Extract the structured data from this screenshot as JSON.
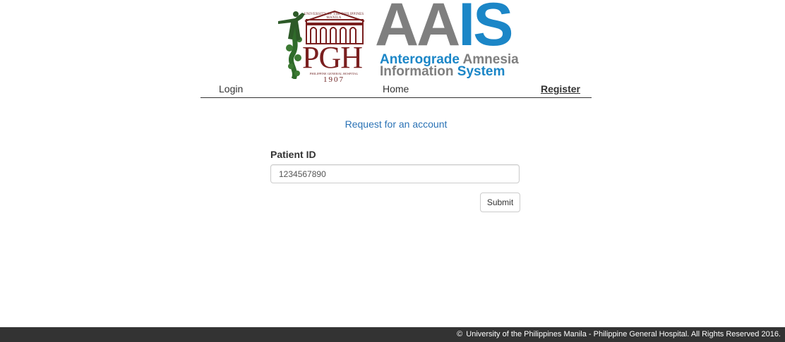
{
  "logo": {
    "seal_university": "UNIVERSITY OF THE PHILIPPINES MANILA",
    "seal_letters": "PGH",
    "seal_hospital": "PHILIPPINE GENERAL HOSPITAL",
    "seal_year": "1907",
    "title_gray": "AA",
    "title_blue": "IS",
    "sub_anterograde": "Anterograde",
    "sub_amnesia": "Amnesia",
    "sub_information": "Information",
    "sub_system": "System"
  },
  "nav": {
    "login": "Login",
    "home": "Home",
    "register": "Register"
  },
  "form": {
    "heading": "Request for an account",
    "patient_id_label": "Patient ID",
    "patient_id_value": "1234567890",
    "submit_label": "Submit"
  },
  "footer": {
    "copyright_symbol": "©",
    "text": "University of the Philippines Manila - Philippine General Hospital. All Rights Reserved 2016."
  },
  "colors": {
    "brand_blue": "#1b86c7",
    "brand_gray": "#7f7f7f",
    "seal_maroon": "#7a1f1f",
    "seal_green": "#2f6b2a",
    "footer_bg": "#333333",
    "heading_blue": "#2a72b5"
  },
  "icons": {
    "copyright": "copyright-icon",
    "statue": "oblation-statue-icon"
  }
}
